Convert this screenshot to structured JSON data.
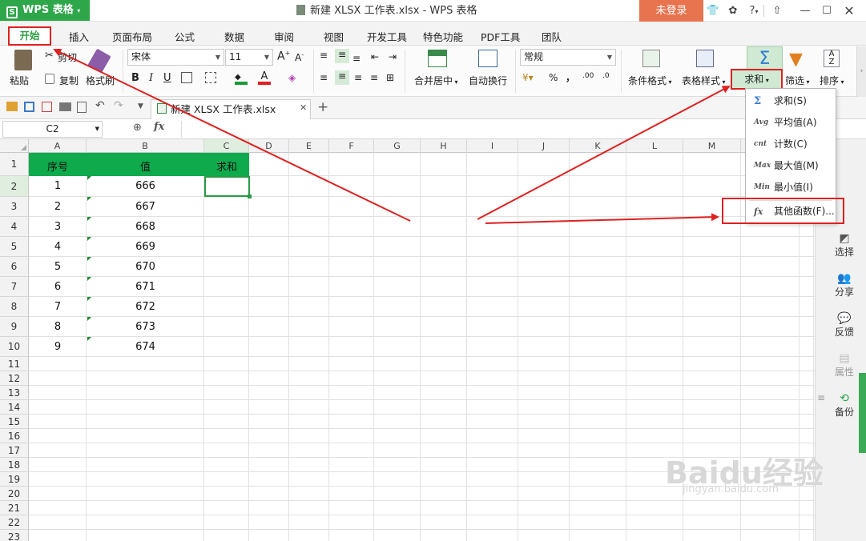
{
  "app": {
    "name": "WPS 表格",
    "s_logo": "S"
  },
  "title": "新建 XLSX 工作表.xlsx - WPS 表格",
  "login": "未登录",
  "titlebar_icons": [
    "shirt-icon",
    "chat-icon",
    "help-icon",
    "minimize-icon",
    "maximize-icon",
    "close-icon"
  ],
  "help_label": "?",
  "menu_tabs": [
    "开始",
    "插入",
    "页面布局",
    "公式",
    "数据",
    "审阅",
    "视图",
    "开发工具",
    "特色功能",
    "PDF工具",
    "团队"
  ],
  "ribbon": {
    "paste": "粘贴",
    "cut": "剪切",
    "copy": "复制",
    "format_painter": "格式刷",
    "font_name": "宋体",
    "font_size": "11",
    "bold": "B",
    "italic": "I",
    "underline": "U",
    "merge_center": "合并居中",
    "wrap_text": "自动换行",
    "number_format": "常规",
    "percent": "%",
    "comma": "，",
    "inc_dec": ".00",
    "dec_dec": ".0",
    "cond_format": "条件格式",
    "table_style": "表格样式",
    "sum": "求和",
    "filter": "筛选",
    "sort": "排序"
  },
  "file_tab": "新建 XLSX 工作表.xlsx",
  "name_box": "C2",
  "fx": "fx",
  "columns": [
    "A",
    "B",
    "C",
    "D",
    "E",
    "F",
    "G",
    "H",
    "I",
    "J",
    "K",
    "L",
    "M"
  ],
  "rows": [
    "1",
    "2",
    "3",
    "4",
    "5",
    "6",
    "7",
    "8",
    "9",
    "10",
    "11",
    "12",
    "13",
    "14",
    "15",
    "16",
    "17",
    "18",
    "19",
    "20",
    "21",
    "22",
    "23"
  ],
  "header": {
    "a": "序号",
    "b": "值",
    "c": "求和"
  },
  "data": [
    {
      "a": "1",
      "b": "666"
    },
    {
      "a": "2",
      "b": "667"
    },
    {
      "a": "3",
      "b": "668"
    },
    {
      "a": "4",
      "b": "669"
    },
    {
      "a": "5",
      "b": "670"
    },
    {
      "a": "6",
      "b": "671"
    },
    {
      "a": "7",
      "b": "672"
    },
    {
      "a": "8",
      "b": "673"
    },
    {
      "a": "9",
      "b": "674"
    }
  ],
  "dropdown": [
    {
      "icon": "Σ",
      "label": "求和(S)"
    },
    {
      "icon": "Avg",
      "label": "平均值(A)"
    },
    {
      "icon": "cnt",
      "label": "计数(C)"
    },
    {
      "icon": "Max",
      "label": "最大值(M)"
    },
    {
      "icon": "Min",
      "label": "最小值(I)"
    },
    {
      "icon": "fx",
      "label": "其他函数(F)..."
    }
  ],
  "side_panel": [
    "选择",
    "分享",
    "反馈",
    "属性",
    "备份"
  ],
  "watermark": {
    "main": "Baidu经验",
    "sub": "jingyan.baidu.com"
  },
  "colors": {
    "accent": "#2ea64a",
    "header_fill": "#0eaa4c",
    "annotation_red": "#e02020",
    "login_orange": "#e8734f"
  }
}
